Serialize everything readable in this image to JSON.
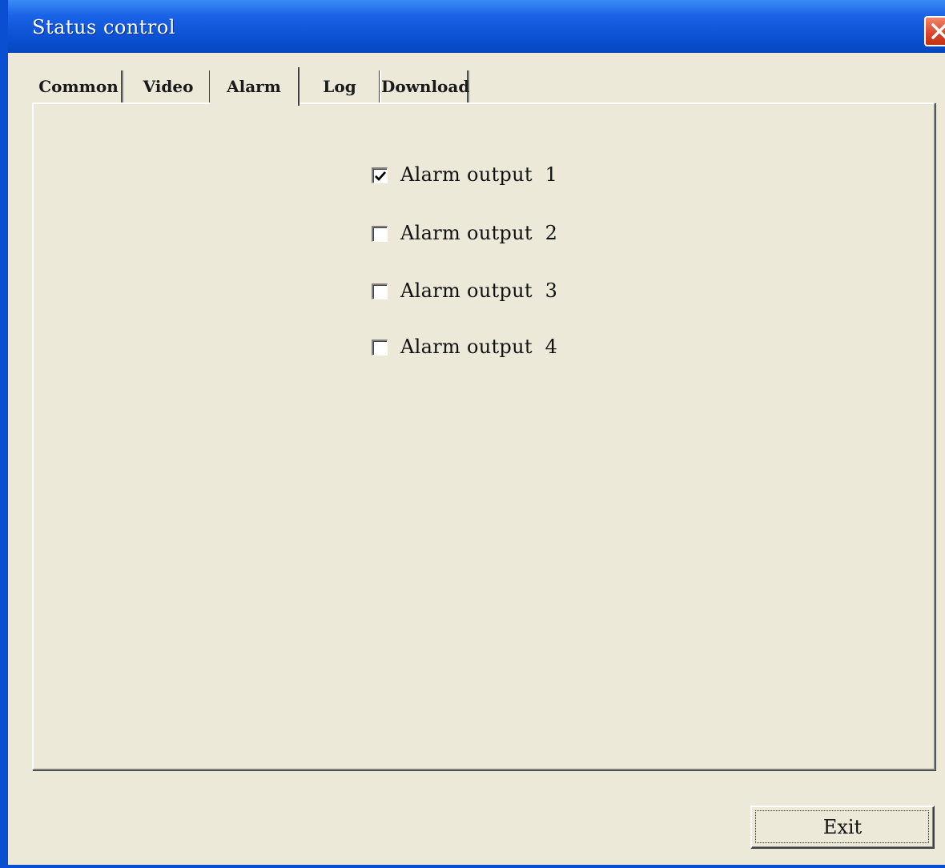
{
  "window": {
    "title": "Status control"
  },
  "titlebar": {
    "close_icon": "close-icon"
  },
  "tabs": [
    {
      "label": "Common",
      "selected": false
    },
    {
      "label": "Video",
      "selected": false
    },
    {
      "label": "Alarm",
      "selected": true
    },
    {
      "label": "Log",
      "selected": false
    },
    {
      "label": "Download",
      "selected": false
    }
  ],
  "alarm": {
    "outputs": [
      {
        "label": "Alarm output  1",
        "checked": true
      },
      {
        "label": "Alarm output  2",
        "checked": false
      },
      {
        "label": "Alarm output  3",
        "checked": false
      },
      {
        "label": "Alarm output  4",
        "checked": false
      }
    ]
  },
  "footer": {
    "exit_label": "Exit"
  },
  "colors": {
    "titlebar": "#0a4fd1",
    "face": "#ece9d8",
    "close": "#d9432a"
  }
}
